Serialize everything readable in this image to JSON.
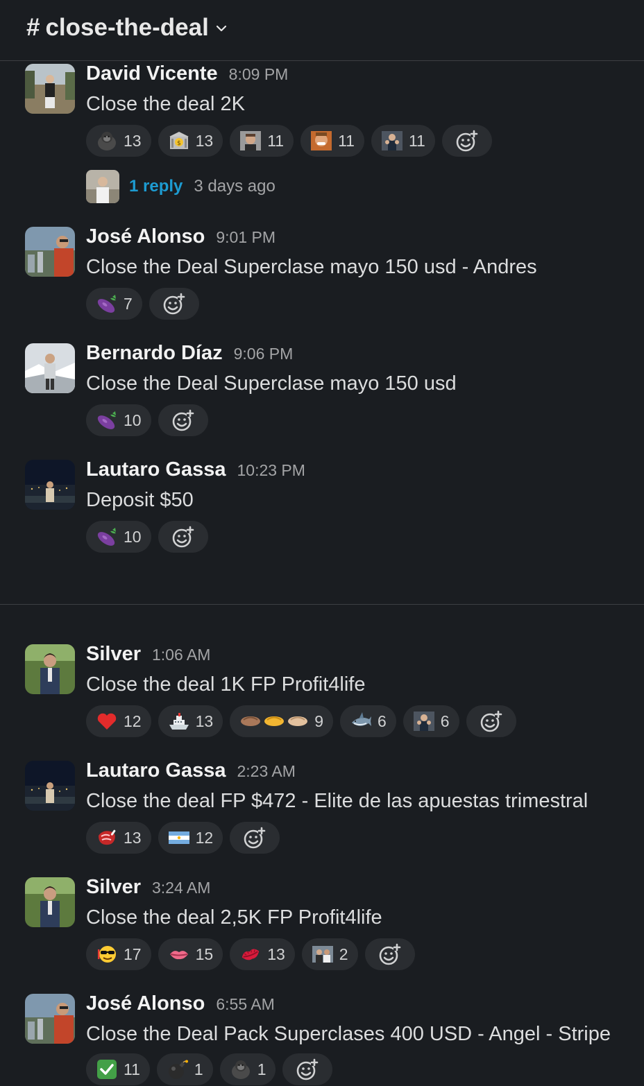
{
  "channel": {
    "hash": "#",
    "name": "close-the-deal"
  },
  "messages": [
    {
      "author": "David Vicente",
      "time": "8:09 PM",
      "text": "Close the deal 2K",
      "reactions": [
        {
          "icon": "gorilla-emoji",
          "count": "13"
        },
        {
          "icon": "bank-emoji",
          "count": "13"
        },
        {
          "icon": "custom-face-emoji",
          "count": "11"
        },
        {
          "icon": "custom-laugh-emoji",
          "count": "11"
        },
        {
          "icon": "custom-clap-emoji",
          "count": "11"
        }
      ],
      "thread": {
        "replies": "1 reply",
        "ago": "3 days ago"
      }
    },
    {
      "author": "José Alonso",
      "time": "9:01 PM",
      "text": "Close the Deal Superclase mayo 150 usd - Andres",
      "reactions": [
        {
          "icon": "eggplant-emoji",
          "count": "7"
        }
      ]
    },
    {
      "author": "Bernardo Díaz",
      "time": "9:06 PM",
      "text": "Close the Deal Superclase mayo 150 usd",
      "reactions": [
        {
          "icon": "eggplant-emoji",
          "count": "10"
        }
      ]
    },
    {
      "author": "Lautaro Gassa",
      "time": "10:23 PM",
      "text": "Deposit $50",
      "reactions": [
        {
          "icon": "eggplant-emoji",
          "count": "10"
        }
      ]
    },
    {
      "author": "Silver",
      "time": "1:06 AM",
      "text": "Close the deal 1K FP Profit4life",
      "reactions": [
        {
          "icon": "heart-emoji",
          "count": "12"
        },
        {
          "icon": "ship-emoji",
          "count": "13"
        },
        {
          "icon": "handshake-emoji",
          "count": "9"
        },
        {
          "icon": "shark-emoji",
          "count": "6"
        },
        {
          "icon": "custom-clap-emoji",
          "count": "6"
        }
      ]
    },
    {
      "author": "Lautaro Gassa",
      "time": "2:23 AM",
      "text": "Close the deal FP $472 - Elite de las apuestas trimestral",
      "reactions": [
        {
          "icon": "steak-emoji",
          "count": "13"
        },
        {
          "icon": "argentina-flag-emoji",
          "count": "12"
        }
      ]
    },
    {
      "author": "Silver",
      "time": "3:24 AM",
      "text": "Close the deal 2,5K FP Profit4life",
      "reactions": [
        {
          "icon": "sunglasses-face-emoji",
          "count": "17"
        },
        {
          "icon": "lips-emoji",
          "count": "15"
        },
        {
          "icon": "kiss-mark-emoji",
          "count": "13"
        },
        {
          "icon": "custom-people-emoji",
          "count": "2"
        }
      ]
    },
    {
      "author": "José Alonso",
      "time": "6:55 AM",
      "text": "Close the Deal Pack Superclases 400 USD - Angel - Stripe",
      "reactions": [
        {
          "icon": "check-mark-emoji",
          "count": "11"
        },
        {
          "icon": "bomb-emoji",
          "count": "1"
        },
        {
          "icon": "gorilla-emoji",
          "count": "1"
        }
      ]
    }
  ],
  "colors": {
    "background": "#1a1d21",
    "pill": "#2a2d31",
    "link": "#1d9bd1",
    "divider": "#3d3f43"
  }
}
